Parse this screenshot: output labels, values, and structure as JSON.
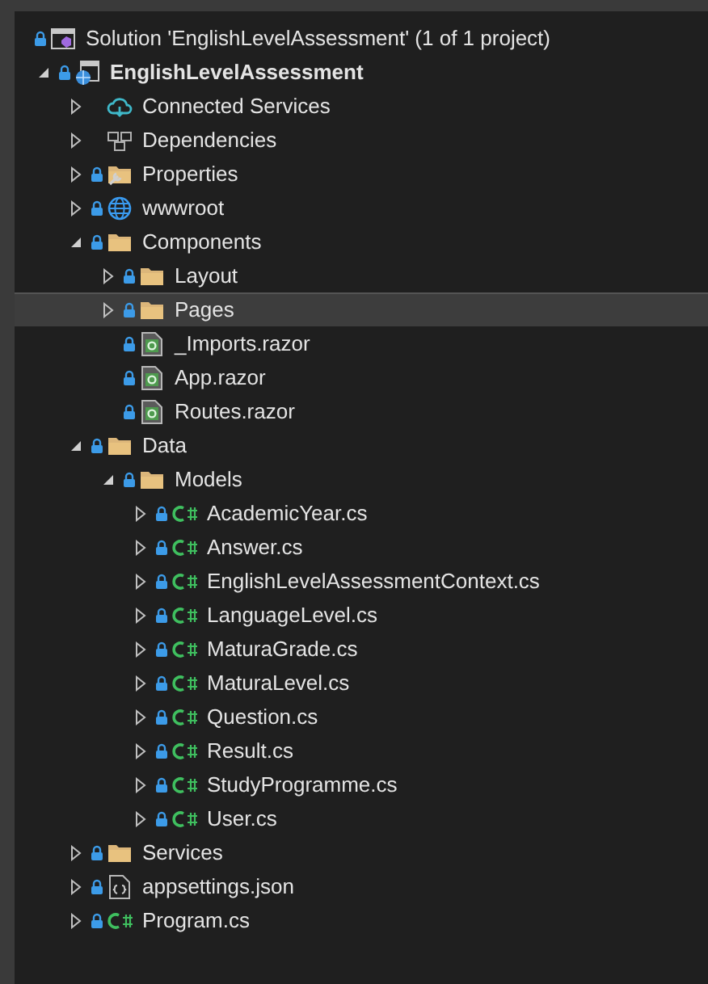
{
  "solution": {
    "label": "Solution 'EnglishLevelAssessment' (1 of 1 project)",
    "locked": true
  },
  "tree": [
    {
      "label": "EnglishLevelAssessment",
      "kind": "project",
      "locked": true,
      "expanded": true,
      "selected": false,
      "children": [
        {
          "label": "Connected Services",
          "kind": "connected",
          "locked": false,
          "expanded": false,
          "selected": false
        },
        {
          "label": "Dependencies",
          "kind": "dependencies",
          "locked": false,
          "expanded": false,
          "selected": false
        },
        {
          "label": "Properties",
          "kind": "properties",
          "locked": true,
          "expanded": false,
          "selected": false
        },
        {
          "label": "wwwroot",
          "kind": "globe",
          "locked": true,
          "expanded": false,
          "selected": false
        },
        {
          "label": "Components",
          "kind": "folder",
          "locked": true,
          "expanded": true,
          "selected": false,
          "children": [
            {
              "label": "Layout",
              "kind": "folder",
              "locked": true,
              "expanded": false,
              "selected": false
            },
            {
              "label": "Pages",
              "kind": "folder",
              "locked": true,
              "expanded": false,
              "selected": true
            },
            {
              "label": "_Imports.razor",
              "kind": "razor",
              "locked": true,
              "selected": false
            },
            {
              "label": "App.razor",
              "kind": "razor",
              "locked": true,
              "selected": false
            },
            {
              "label": "Routes.razor",
              "kind": "razor",
              "locked": true,
              "selected": false
            }
          ]
        },
        {
          "label": "Data",
          "kind": "folder",
          "locked": true,
          "expanded": true,
          "selected": false,
          "children": [
            {
              "label": "Models",
              "kind": "folder",
              "locked": true,
              "expanded": true,
              "selected": false,
              "children": [
                {
                  "label": "AcademicYear.cs",
                  "kind": "cs",
                  "locked": true,
                  "expanded": false,
                  "selected": false
                },
                {
                  "label": "Answer.cs",
                  "kind": "cs",
                  "locked": true,
                  "expanded": false,
                  "selected": false
                },
                {
                  "label": "EnglishLevelAssessmentContext.cs",
                  "kind": "cs",
                  "locked": true,
                  "expanded": false,
                  "selected": false
                },
                {
                  "label": "LanguageLevel.cs",
                  "kind": "cs",
                  "locked": true,
                  "expanded": false,
                  "selected": false
                },
                {
                  "label": "MaturaGrade.cs",
                  "kind": "cs",
                  "locked": true,
                  "expanded": false,
                  "selected": false
                },
                {
                  "label": "MaturaLevel.cs",
                  "kind": "cs",
                  "locked": true,
                  "expanded": false,
                  "selected": false
                },
                {
                  "label": "Question.cs",
                  "kind": "cs",
                  "locked": true,
                  "expanded": false,
                  "selected": false
                },
                {
                  "label": "Result.cs",
                  "kind": "cs",
                  "locked": true,
                  "expanded": false,
                  "selected": false
                },
                {
                  "label": "StudyProgramme.cs",
                  "kind": "cs",
                  "locked": true,
                  "expanded": false,
                  "selected": false
                },
                {
                  "label": "User.cs",
                  "kind": "cs",
                  "locked": true,
                  "expanded": false,
                  "selected": false
                }
              ]
            }
          ]
        },
        {
          "label": "Services",
          "kind": "folder",
          "locked": true,
          "expanded": false,
          "selected": false
        },
        {
          "label": "appsettings.json",
          "kind": "json",
          "locked": true,
          "expanded": false,
          "selected": false
        },
        {
          "label": "Program.cs",
          "kind": "cs",
          "locked": true,
          "expanded": false,
          "selected": false
        }
      ]
    }
  ]
}
